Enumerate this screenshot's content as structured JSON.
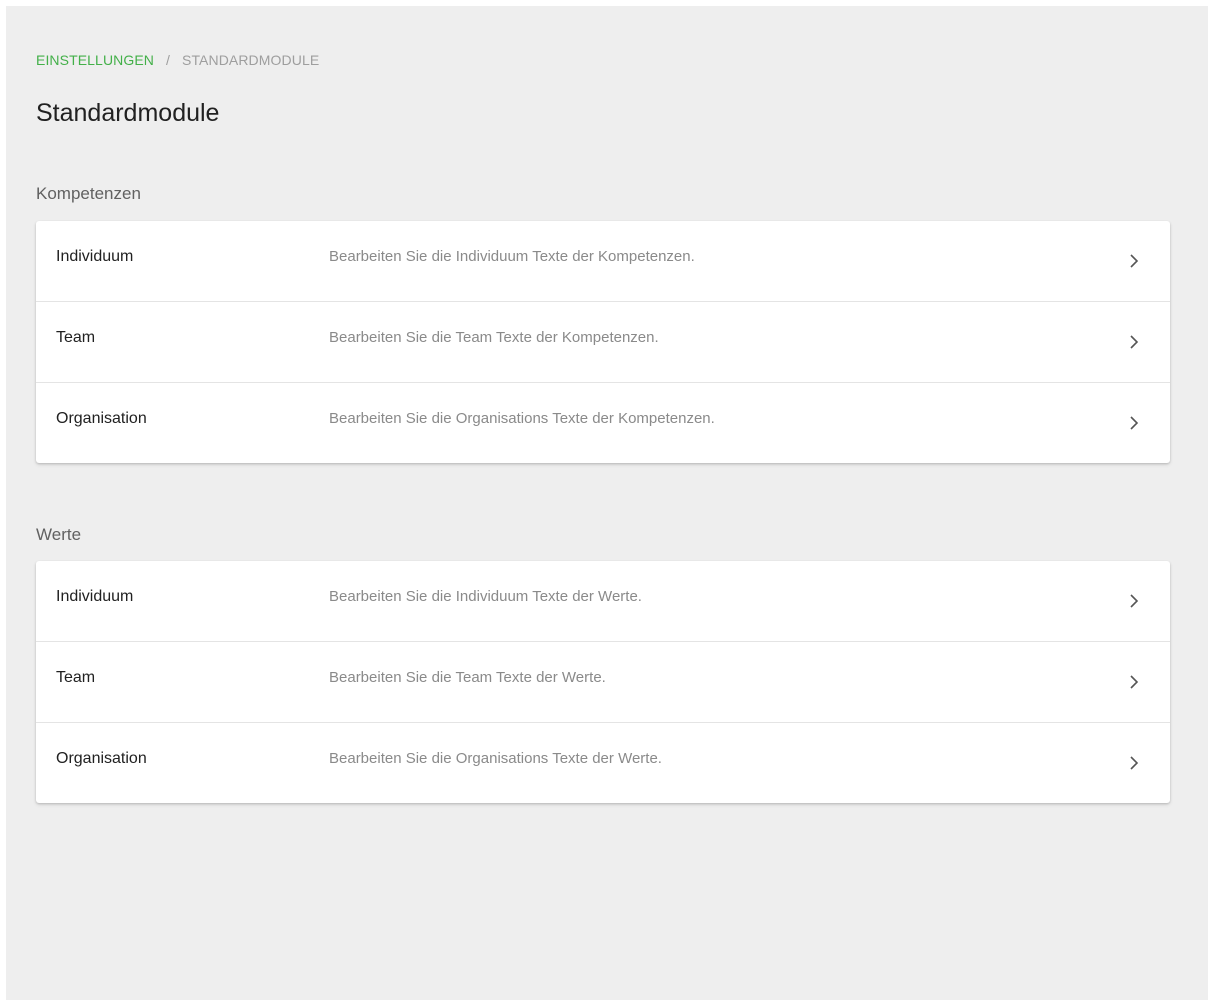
{
  "breadcrumb": {
    "root": "EINSTELLUNGEN",
    "separator": "/",
    "current": "STANDARDMODULE"
  },
  "page": {
    "title": "Standardmodule"
  },
  "sections": [
    {
      "heading": "Kompetenzen",
      "items": [
        {
          "label": "Individuum",
          "description": "Bearbeiten Sie die Individuum Texte der Kompetenzen."
        },
        {
          "label": "Team",
          "description": "Bearbeiten Sie die Team Texte der Kompetenzen."
        },
        {
          "label": "Organisation",
          "description": "Bearbeiten Sie die Organisations Texte der Kompetenzen."
        }
      ]
    },
    {
      "heading": "Werte",
      "items": [
        {
          "label": "Individuum",
          "description": "Bearbeiten Sie die Individuum Texte der Werte."
        },
        {
          "label": "Team",
          "description": "Bearbeiten Sie die Team Texte der Werte."
        },
        {
          "label": "Organisation",
          "description": "Bearbeiten Sie die Organisations Texte der Werte."
        }
      ]
    }
  ],
  "icons": {
    "row_arrow": "chevron-right-icon"
  },
  "colors": {
    "accent": "#43b049",
    "background": "#eeeeee",
    "card": "#ffffff",
    "text_primary": "#212121",
    "text_secondary": "#8a8a8a"
  }
}
